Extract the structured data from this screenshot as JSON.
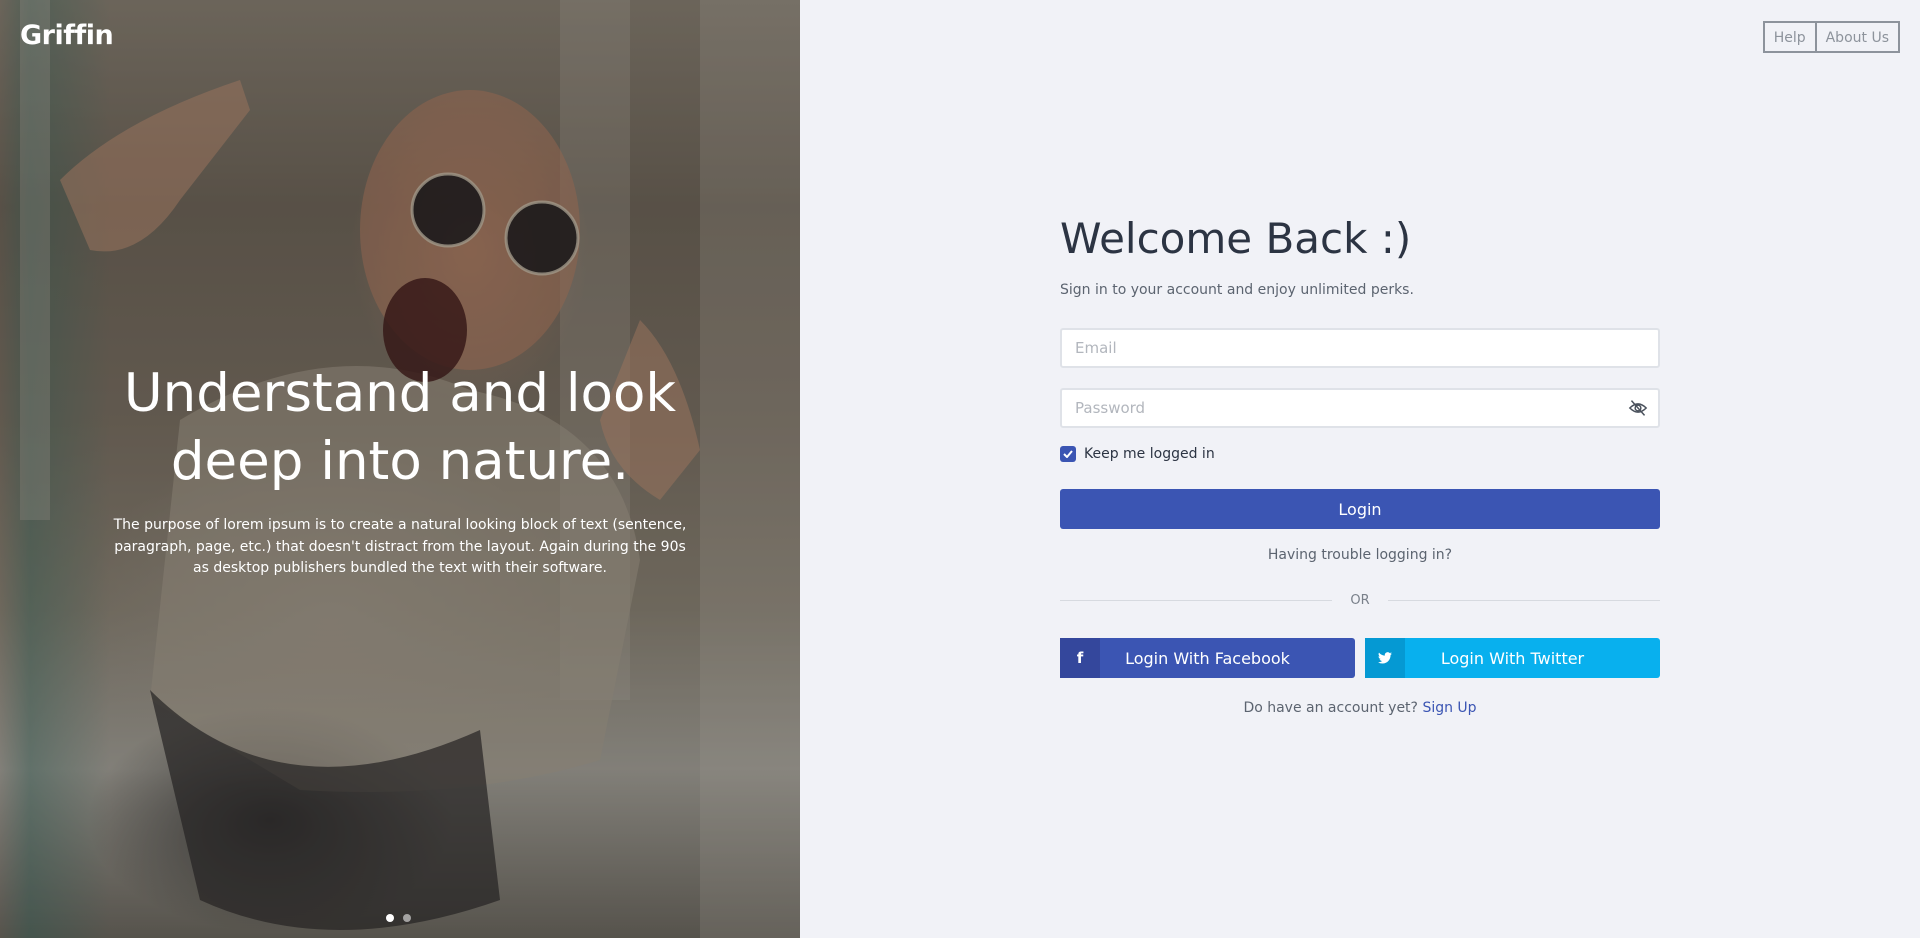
{
  "brand": {
    "logo": "Griffin"
  },
  "nav": {
    "help": "Help",
    "about": "About Us"
  },
  "hero": {
    "title_line1": "Understand and look",
    "title_line2": "deep into nature.",
    "text": "The purpose of lorem ipsum is to create a natural looking block of text (sentence, paragraph, page, etc.) that doesn't distract from the layout. Again during the 90s as desktop publishers bundled the text with their software.",
    "slides": 2,
    "active_slide": 1
  },
  "form": {
    "title": "Welcome Back :)",
    "subtitle": "Sign in to your account and enjoy unlimited perks.",
    "email_placeholder": "Email",
    "password_placeholder": "Password",
    "remember_label": "Keep me logged in",
    "remember_checked": true,
    "login_label": "Login",
    "trouble_label": "Having trouble logging in?",
    "or_label": "OR",
    "facebook_label": "Login With Facebook",
    "twitter_label": "Login With Twitter",
    "signup_prompt": "Do have an account yet?",
    "signup_link": "Sign Up"
  },
  "colors": {
    "primary": "#3b55b3",
    "twitter": "#08b0ee",
    "background": "#f1f2f7"
  },
  "icons": {
    "password_toggle": "eye-off-icon",
    "facebook": "facebook-icon",
    "twitter": "twitter-icon",
    "checkbox": "check-icon"
  }
}
